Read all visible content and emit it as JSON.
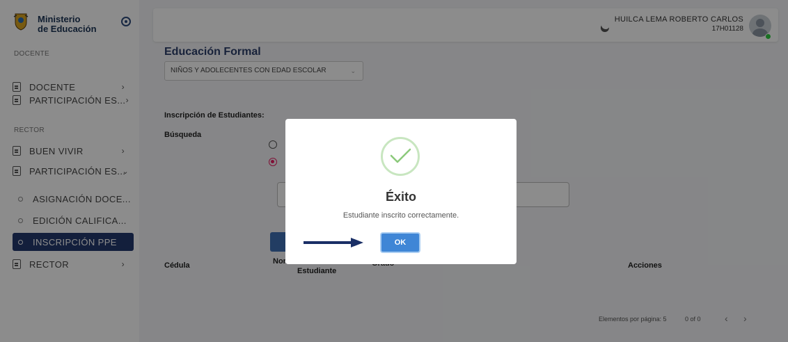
{
  "sidebar": {
    "brand": {
      "line1": "Ministerio",
      "line2": "de Educación"
    },
    "sections": [
      {
        "label": "DOCENTE"
      },
      {
        "label": "RECTOR"
      }
    ],
    "items": [
      {
        "label": "DOCENTE",
        "chevron": "›"
      },
      {
        "label": "PARTICIPACIÓN ES...",
        "chevron": "›"
      },
      {
        "label": "BUEN VIVIR",
        "chevron": "›"
      },
      {
        "label": "PARTICIPACIÓN ES...",
        "chevron": "⌄"
      },
      {
        "label": "ASIGNACIÓN DOCE..."
      },
      {
        "label": "EDICIÓN CALIFICA..."
      },
      {
        "label": "INSCRIPCIÓN PPE"
      },
      {
        "label": "RECTOR",
        "chevron": "›"
      }
    ]
  },
  "topbar": {
    "user_name": "HUILCA LEMA ROBERTO CARLOS",
    "user_id": "17H01128"
  },
  "main": {
    "title": "Educación Formal",
    "select_value": "NIÑOS Y ADOLECENTES CON EDAD ESCOLAR",
    "inscription_label": "Inscripción de Estudiantes:",
    "search_label": "Búsqueda",
    "table_headers": {
      "cedula": "Cédula",
      "nombre_partial": "Nor",
      "estudiante": "Estudiante",
      "grado": "Grado",
      "acciones": "Acciones"
    },
    "pager": {
      "per_page": "Elementos por página: 5",
      "range": "0 of 0",
      "prev": "‹",
      "next": "›"
    }
  },
  "modal": {
    "title": "Éxito",
    "message": "Estudiante inscrito correctamente.",
    "ok_label": "OK"
  },
  "colors": {
    "accent": "#243a6d",
    "ok_button": "#3f86d6",
    "success": "#8bc97a",
    "radio_checked": "#e91e63"
  }
}
